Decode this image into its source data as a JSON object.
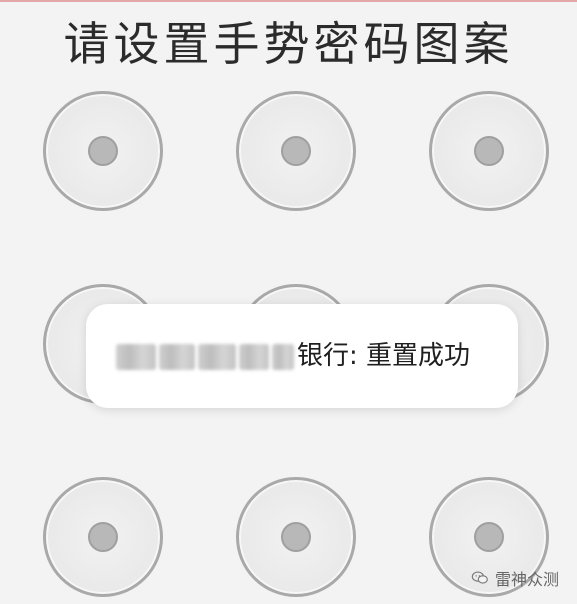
{
  "title": "请设置手势密码图案",
  "gesture_grid": {
    "rows": 3,
    "cols": 3
  },
  "toast": {
    "message": "银行: 重置成功",
    "redacted_prefix": true
  },
  "watermark": {
    "text": "雷神众测"
  },
  "colors": {
    "background": "#f3f3f3",
    "node_border": "#a9a9a9",
    "node_fill": "#eeeeee",
    "node_center": "#b8b8b8",
    "toast_bg": "#ffffff",
    "title_text": "#2b2b2b"
  }
}
